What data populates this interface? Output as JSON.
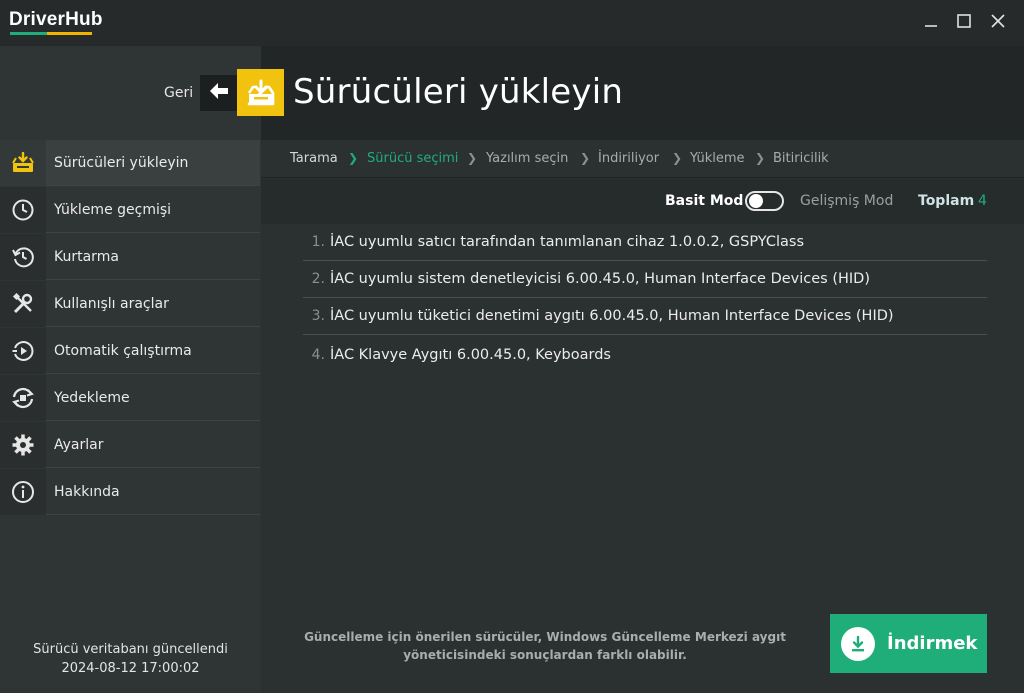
{
  "app": {
    "name": "DriverHub",
    "colors": {
      "accent": "#1fae7a",
      "brand_yellow": "#f2c30e"
    }
  },
  "window": {
    "minimize_icon": "minimize-icon",
    "maximize_icon": "maximize-icon",
    "close_icon": "close-icon"
  },
  "header": {
    "back_label": "Geri",
    "title": "Sürücüleri yükleyin"
  },
  "sidebar": {
    "items": [
      {
        "label": "Sürücüleri yükleyin",
        "icon": "driver-install-icon",
        "active": true
      },
      {
        "label": "Yükleme geçmişi",
        "icon": "history-clock-icon"
      },
      {
        "label": "Kurtarma",
        "icon": "restore-icon"
      },
      {
        "label": "Kullanışlı araçlar",
        "icon": "tools-icon"
      },
      {
        "label": "Otomatik çalıştırma",
        "icon": "autorun-icon"
      },
      {
        "label": "Yedekleme",
        "icon": "backup-icon"
      },
      {
        "label": "Ayarlar",
        "icon": "gear-icon"
      },
      {
        "label": "Hakkında",
        "icon": "info-icon"
      }
    ],
    "db_status_line1": "Sürücü veritabanı güncellendi",
    "db_status_line2": "2024-08-12 17:00:02"
  },
  "breadcrumb": {
    "steps": [
      "Tarama",
      "Sürücü seçimi",
      "Yazılım seçin",
      "İndiriliyor",
      "Yükleme",
      "Bitiricilik"
    ],
    "current_index": 1
  },
  "mode": {
    "basic_label": "Basit Mod",
    "advanced_label": "Gelişmiş Mod",
    "total_label": "Toplam",
    "total_count": "4"
  },
  "drivers": [
    {
      "num": "1.",
      "name": "İAC uyumlu satıcı tarafından tanımlanan cihaz 1.0.0.2, GSPYClass"
    },
    {
      "num": "2.",
      "name": "İAC uyumlu sistem denetleyicisi 6.00.45.0, Human Interface Devices (HID)"
    },
    {
      "num": "3.",
      "name": "İAC uyumlu tüketici denetimi aygıtı 6.00.45.0, Human Interface Devices (HID)"
    },
    {
      "num": "4.",
      "name": "İAC Klavye Aygıtı 6.00.45.0, Keyboards"
    }
  ],
  "footer": {
    "notice_line1": "Güncelleme için önerilen sürücüler, Windows Güncelleme Merkezi aygıt",
    "notice_line2": "yöneticisindeki sonuçlardan farklı olabilir.",
    "download_label": "İndirmek"
  }
}
